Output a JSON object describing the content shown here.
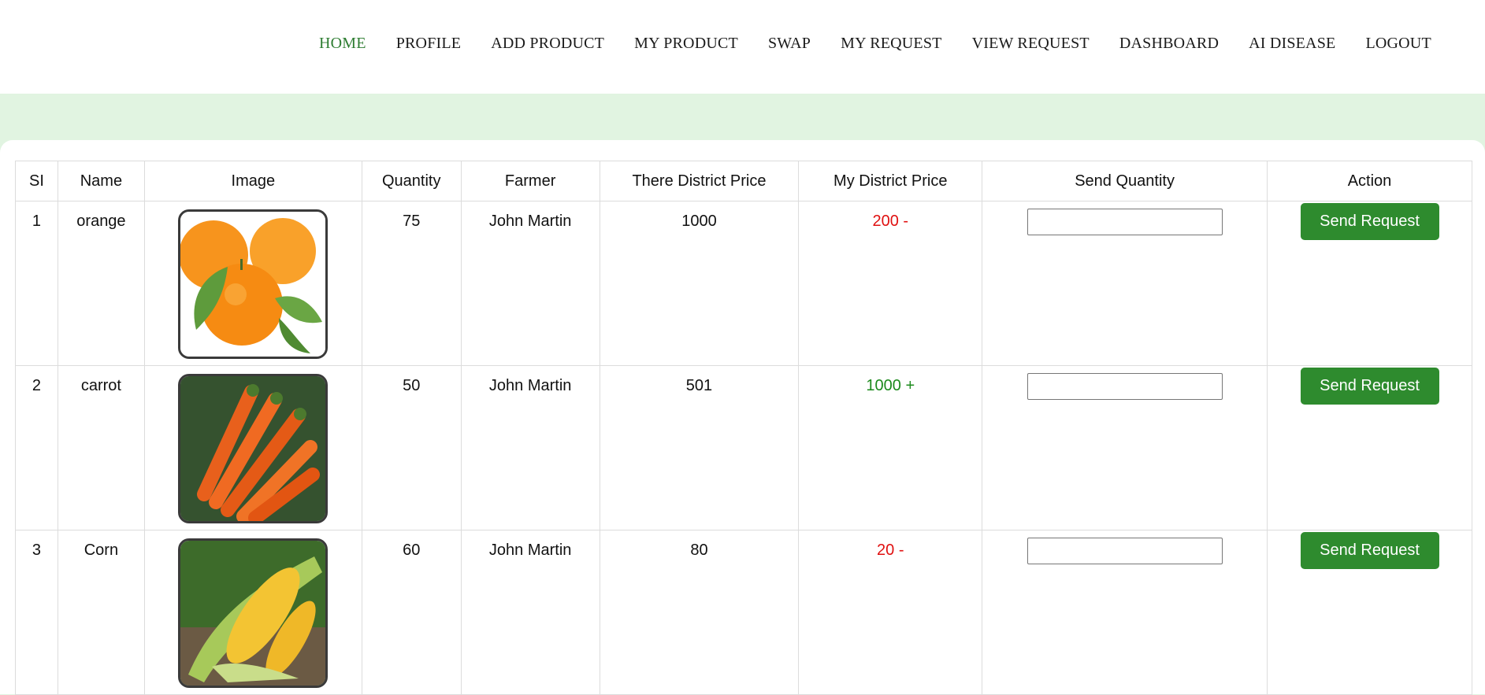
{
  "nav": {
    "items": [
      {
        "label": "HOME",
        "active": true
      },
      {
        "label": "PROFILE"
      },
      {
        "label": "ADD PRODUCT"
      },
      {
        "label": "MY PRODUCT"
      },
      {
        "label": "SWAP"
      },
      {
        "label": "MY REQUEST"
      },
      {
        "label": "VIEW REQUEST"
      },
      {
        "label": "DASHBOARD"
      },
      {
        "label": "AI DISEASE"
      },
      {
        "label": "LOGOUT"
      }
    ],
    "active_color": "#2e7d32"
  },
  "table": {
    "headers": [
      "SI",
      "Name",
      "Image",
      "Quantity",
      "Farmer",
      "There District Price",
      "My District Price",
      "Send Quantity",
      "Action"
    ],
    "rows": [
      {
        "si": "1",
        "name": "orange",
        "image": "orange-image",
        "quantity": "75",
        "farmer": "John Martin",
        "there_price": "1000",
        "my_price": "200 -",
        "price_status": "lower",
        "send_quantity": "",
        "action": "Send Request"
      },
      {
        "si": "2",
        "name": "carrot",
        "image": "carrot-image",
        "quantity": "50",
        "farmer": "John Martin",
        "there_price": "501",
        "my_price": "1000 +",
        "price_status": "higher",
        "send_quantity": "",
        "action": "Send Request"
      },
      {
        "si": "3",
        "name": "Corn",
        "image": "corn-image",
        "quantity": "60",
        "farmer": "John Martin",
        "there_price": "80",
        "my_price": "20 -",
        "price_status": "lower",
        "send_quantity": "",
        "action": "Send Request"
      }
    ]
  },
  "colors": {
    "background": "#e1f4e1",
    "button": "#2e8b2e",
    "price_lower": "#e01010",
    "price_higher": "#1c8a1c"
  }
}
